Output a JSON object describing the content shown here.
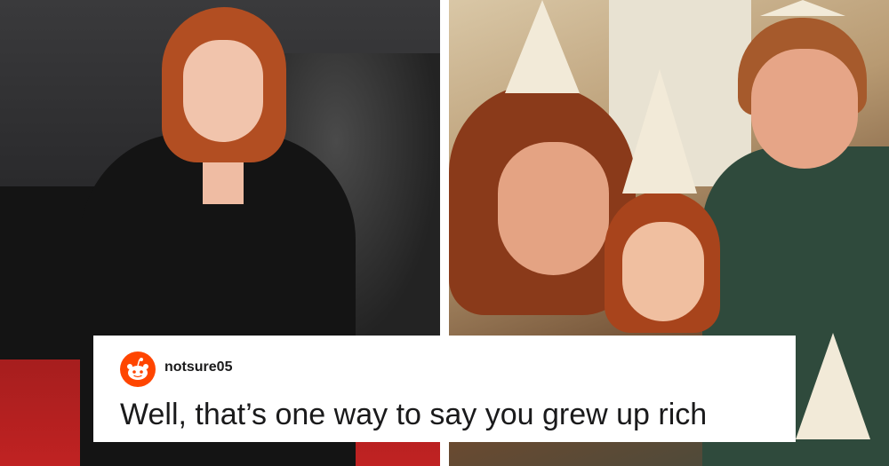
{
  "comment_card": {
    "username": "notsure05",
    "comment_text": "Well, that’s one way to say you grew up rich",
    "avatar_icon": "reddit-avatar-icon",
    "accent_color": "#ff4500"
  },
  "colors": {
    "card_background": "#ffffff",
    "text": "#1a1a1b",
    "carpet": "#c02222"
  }
}
